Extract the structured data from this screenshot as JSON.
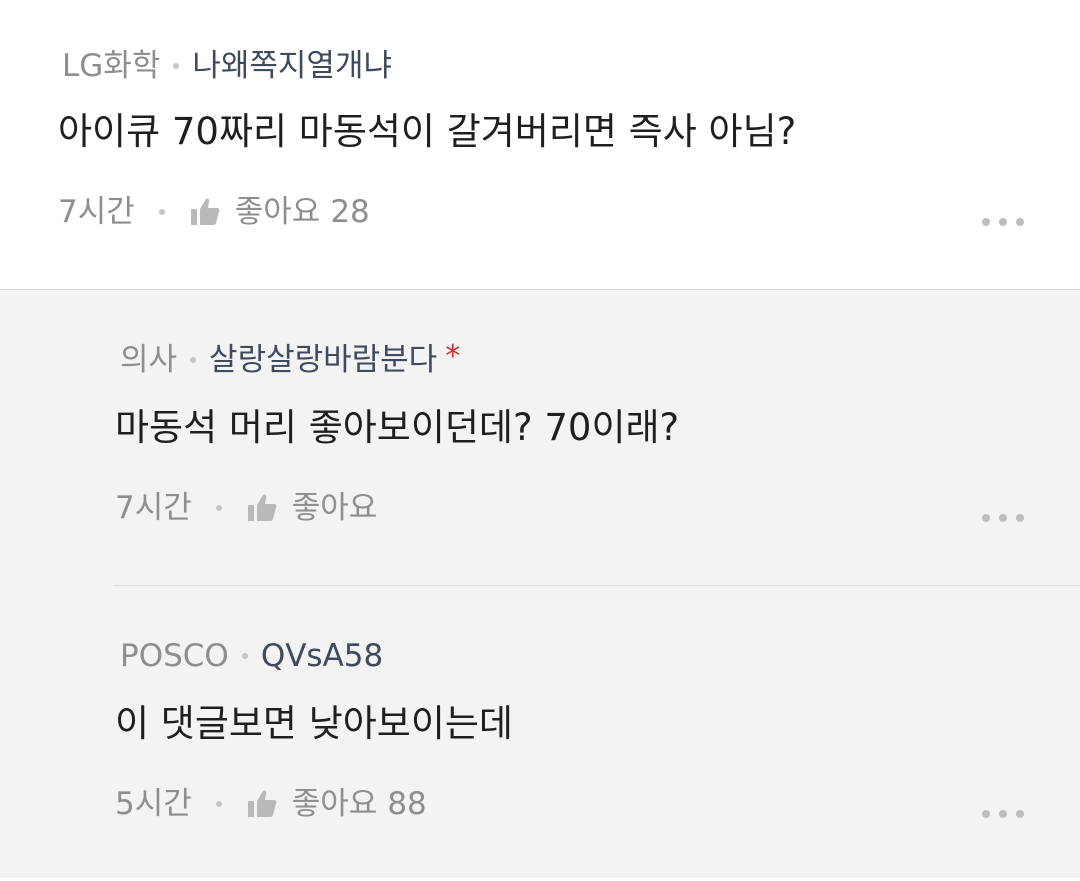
{
  "comments": [
    {
      "company": "LG화학",
      "nickname": "나왜쪽지열개냐",
      "text": "아이큐 70짜리 마동석이 갈겨버리면 즉사 아님?",
      "time": "7시간",
      "like_label": "좋아요",
      "like_count": "28"
    }
  ],
  "replies": [
    {
      "company": "의사",
      "nickname": "살랑살랑바람분다",
      "marker": "*",
      "text": "마동석 머리 좋아보이던데? 70이래?",
      "time": "7시간",
      "like_label": "좋아요",
      "like_count": ""
    },
    {
      "company": "POSCO",
      "nickname": "QVsA58",
      "text": "이 댓글보면 낮아보이는데",
      "time": "5시간",
      "like_label": "좋아요",
      "like_count": "88"
    }
  ],
  "icons": {
    "like": "thumbs-up-icon",
    "more": "more-horizontal-icon"
  },
  "colors": {
    "marker": "#d32f2f",
    "reply_background": "#f3f3f3"
  }
}
